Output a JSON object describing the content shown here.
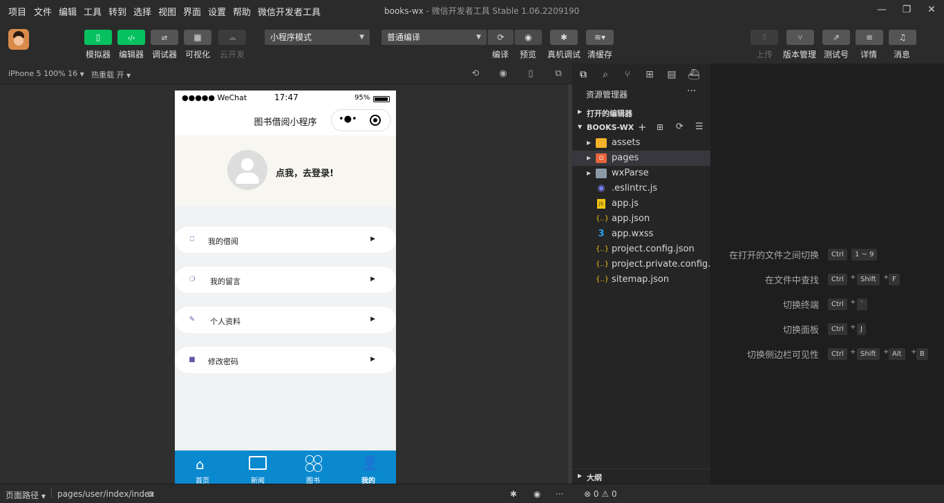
{
  "menu": [
    "项目",
    "文件",
    "编辑",
    "工具",
    "转到",
    "选择",
    "视图",
    "界面",
    "设置",
    "帮助",
    "微信开发者工具"
  ],
  "window": {
    "app": "books-wx",
    "title": " - 微信开发者工具 Stable 1.06.2209190"
  },
  "toolbar": {
    "simulator": "模拟器",
    "editor": "编辑器",
    "debugger": "调试器",
    "visual": "可视化",
    "cloud": "云开发",
    "mode": "小程序模式",
    "compile": "普通编译",
    "compile_btn": "编译",
    "preview_btn": "预览",
    "realdebug_btn": "真机调试",
    "clearcache_btn": "清缓存",
    "upload": "上传",
    "version": "版本管理",
    "test": "测试号",
    "details": "详情",
    "messages": "消息"
  },
  "subbar": {
    "device": "iPhone 5 100% 16",
    "hotreload": "热重载 开"
  },
  "phone": {
    "carrier": "●●●●● WeChat",
    "time": "17:47",
    "battery": "95%",
    "nav_title": "图书借阅小程序",
    "login": "点我，去登录!",
    "rows": [
      {
        "icon": "bookmark-icon",
        "label": "我的借阅"
      },
      {
        "icon": "comment-icon",
        "label": "我的留言"
      },
      {
        "icon": "edit-icon",
        "label": "个人资料"
      },
      {
        "icon": "lock-icon",
        "label": "修改密码"
      }
    ],
    "tabs": [
      {
        "icon": "home-icon",
        "label": "首页"
      },
      {
        "icon": "news-icon",
        "label": "新闻"
      },
      {
        "icon": "books-icon",
        "label": "图书"
      },
      {
        "icon": "user-icon",
        "label": "我的"
      }
    ],
    "colors": {
      "tabbar": "#0a89cf",
      "header": "#f8f6f1"
    }
  },
  "explorer": {
    "title": "资源管理器",
    "open_editors": "打开的编辑器",
    "project": "BOOKS-WX",
    "files": [
      {
        "name": "assets",
        "icon": "folder-icon"
      },
      {
        "name": "pages",
        "icon": "folder-icon"
      },
      {
        "name": "wxParse",
        "icon": "folder-icon"
      },
      {
        "name": ".eslintrc.js",
        "icon": "eslint-icon"
      },
      {
        "name": "app.js",
        "icon": "js-icon"
      },
      {
        "name": "app.json",
        "icon": "json-icon"
      },
      {
        "name": "app.wxss",
        "icon": "css-icon"
      },
      {
        "name": "project.config.json",
        "icon": "json-icon"
      },
      {
        "name": "project.private.config.js...",
        "icon": "json-icon"
      },
      {
        "name": "sitemap.json",
        "icon": "json-icon"
      }
    ],
    "outline": "大纲"
  },
  "editor_hints": [
    {
      "label": "在打开的文件之间切换",
      "keys": [
        "Ctrl",
        "1 ~ 9"
      ]
    },
    {
      "label": "在文件中查找",
      "keys": [
        "Ctrl",
        "Shift",
        "F"
      ]
    },
    {
      "label": "切换终端",
      "keys": [
        "Ctrl",
        "`"
      ]
    },
    {
      "label": "切换面板",
      "keys": [
        "Ctrl",
        "J"
      ]
    },
    {
      "label": "切换侧边栏可见性",
      "keys": [
        "Ctrl",
        "Shift",
        "Alt",
        "B"
      ]
    }
  ],
  "statusbar": {
    "path_label": "页面路径",
    "path": "pages/user/index/index",
    "errors": "0",
    "warnings": "0"
  }
}
